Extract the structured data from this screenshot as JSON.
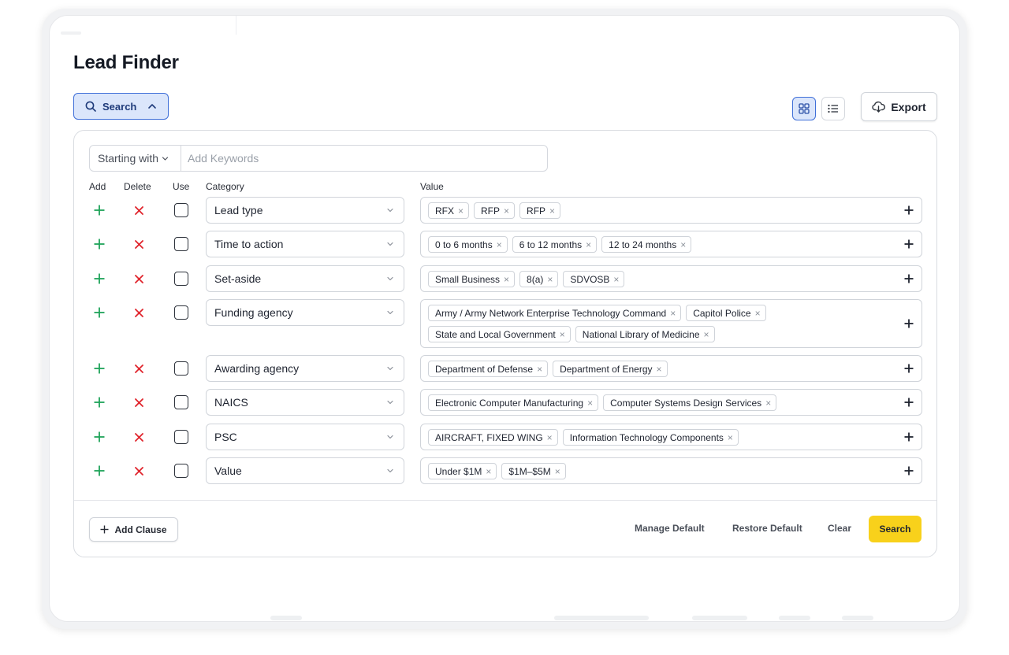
{
  "page": {
    "title": "Lead Finder"
  },
  "toolbar": {
    "search_toggle_label": "Search",
    "export_label": "Export"
  },
  "keyword": {
    "mode_label": "Starting with",
    "placeholder": "Add Keywords"
  },
  "columns": {
    "add": "Add",
    "delete": "Delete",
    "use": "Use",
    "category": "Category",
    "value": "Value"
  },
  "clauses": [
    {
      "category": "Lead type",
      "values": [
        "RFX",
        "RFP",
        "RFP"
      ]
    },
    {
      "category": "Time to action",
      "values": [
        "0 to 6 months",
        "6 to 12 months",
        "12 to 24 months"
      ]
    },
    {
      "category": "Set-aside",
      "values": [
        "Small Business",
        "8(a)",
        "SDVOSB"
      ]
    },
    {
      "category": "Funding agency",
      "values": [
        "Army / Army Network Enterprise Technology Command",
        "Capitol Police",
        "State and Local Government",
        "National Library of Medicine"
      ]
    },
    {
      "category": "Awarding agency",
      "values": [
        "Department of Defense",
        "Department of Energy"
      ]
    },
    {
      "category": "NAICS",
      "values": [
        "Electronic Computer Manufacturing",
        "Computer Systems Design Services"
      ]
    },
    {
      "category": "PSC",
      "values": [
        "AIRCRAFT, FIXED WING",
        "Information Technology Components"
      ]
    },
    {
      "category": "Value",
      "values": [
        "Under $1M",
        "$1M–$5M"
      ]
    }
  ],
  "footer": {
    "add_clause_label": "Add Clause",
    "manage_default_label": "Manage Default",
    "restore_default_label": "Restore Default",
    "clear_label": "Clear",
    "search_label": "Search"
  },
  "colors": {
    "accent_blue": "#3f6fd8",
    "accent_blue_bg": "#dbe6fb",
    "add_green": "#1fa35a",
    "delete_red": "#e0242c",
    "search_yellow": "#f8d11b"
  },
  "icons": {
    "add": "plus-icon",
    "delete": "x-icon",
    "search": "search-icon",
    "export": "cloud-download-icon",
    "grid_view": "grid-icon",
    "list_view": "list-icon"
  }
}
